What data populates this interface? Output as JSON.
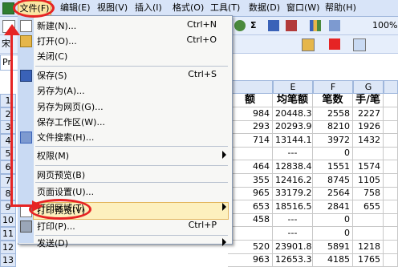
{
  "menubar": {
    "items": [
      {
        "label": "文件(F)"
      },
      {
        "label": "编辑(E)"
      },
      {
        "label": "视图(V)"
      },
      {
        "label": "插入(I)"
      },
      {
        "label": "格式(O)"
      },
      {
        "label": "工具(T)"
      },
      {
        "label": "数据(D)"
      },
      {
        "label": "窗口(W)"
      },
      {
        "label": "帮助(H)"
      }
    ]
  },
  "toolbar": {
    "zoom": "100%",
    "sigma": "Σ",
    "font_fragment": "宋",
    "name_fragment": "Pr"
  },
  "file_menu": {
    "items": [
      {
        "label": "新建(N)...",
        "shortcut": "Ctrl+N"
      },
      {
        "label": "打开(O)...",
        "shortcut": "Ctrl+O"
      },
      {
        "label": "关闭(C)",
        "shortcut": ""
      },
      {
        "label": "保存(S)",
        "shortcut": "Ctrl+S"
      },
      {
        "label": "另存为(A)...",
        "shortcut": ""
      },
      {
        "label": "另存为网页(G)...",
        "shortcut": ""
      },
      {
        "label": "保存工作区(W)...",
        "shortcut": ""
      },
      {
        "label": "文件搜索(H)...",
        "shortcut": ""
      },
      {
        "label": "权限(M)",
        "shortcut": ""
      },
      {
        "label": "网页预览(B)",
        "shortcut": ""
      },
      {
        "label": "页面设置(U)...",
        "shortcut": ""
      },
      {
        "label": "打印区域(T)",
        "shortcut": ""
      },
      {
        "label": "打印预览(V)",
        "shortcut": ""
      },
      {
        "label": "打印(P)...",
        "shortcut": "Ctrl+P"
      },
      {
        "label": "发送(D)",
        "shortcut": ""
      }
    ]
  },
  "sheet": {
    "columns": [
      "E",
      "F",
      "G"
    ],
    "rows": [
      "1",
      "2",
      "3",
      "4",
      "5",
      "6",
      "7",
      "8",
      "9",
      "10",
      "11",
      "12",
      "13"
    ],
    "partial_col": [
      "额",
      "984",
      "293",
      "714",
      "",
      "464",
      "355",
      "965",
      "653",
      "458",
      "",
      "520",
      "963"
    ],
    "col_e": [
      "均笔额",
      "20448.39",
      "20293.97",
      "13144.19",
      "---",
      "12838.47",
      "12416.28",
      "33179.27",
      "18516.53",
      "---",
      "---",
      "23901.81",
      "12653.34"
    ],
    "col_f": [
      "笔数",
      "2558",
      "8210",
      "3972",
      "0",
      "1551",
      "8745",
      "2564",
      "2841",
      "0",
      "0",
      "5891",
      "4185"
    ],
    "col_g": [
      "手/笔",
      "2227",
      "1926",
      "1432",
      "",
      "1574",
      "1105",
      "758",
      "655",
      "",
      "",
      "1218",
      "1765"
    ]
  },
  "colors": {
    "accent": "#e62424",
    "highlight": "#fdf0be",
    "menu_bg": "#d8e4f8"
  }
}
